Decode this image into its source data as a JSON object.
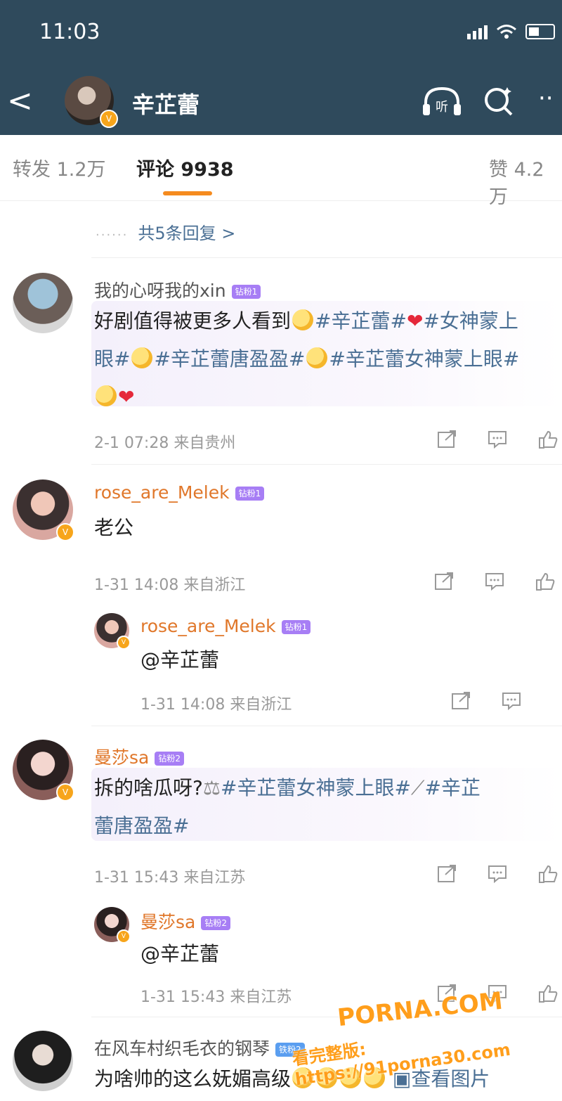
{
  "status_bar": {
    "time": "11:03"
  },
  "header": {
    "back": "<",
    "title": "辛芷蕾",
    "listen": "听",
    "more": "··"
  },
  "tabs": {
    "repost": "转发 1.2万",
    "comments": "评论 9938",
    "likes": "赞 4.2万"
  },
  "more_replies": "共5条回复 >",
  "comments": [
    {
      "name": "我的心呀我的xin",
      "badge": "钻粉1",
      "text_1": "好剧值得被更多人看到",
      "tag_1": "#辛芷蕾#",
      "tag_2": "#女神蒙上",
      "tag_3": "眼#",
      "tag_4": "#辛芷蕾唐盈盈#",
      "tag_5": "#辛芷蕾女神蒙上眼#",
      "meta": "2-1 07:28 来自贵州"
    },
    {
      "name": "rose_are_Melek",
      "badge": "钻粉1",
      "text": "老公",
      "meta": "1-31 14:08 来自浙江",
      "reply": {
        "name": "rose_are_Melek",
        "badge": "钻粉1",
        "text": "@辛芷蕾",
        "meta": "1-31 14:08 来自浙江"
      }
    },
    {
      "name": "曼莎sa",
      "badge": "钻粉2",
      "text": "拆的啥瓜呀?",
      "tag_1": "#辛芷蕾女神蒙上眼#",
      "tag_2": "#辛芷",
      "tag_3": "蕾唐盈盈#",
      "meta": "1-31 15:43 来自江苏",
      "reply": {
        "name": "曼莎sa",
        "badge": "钻粉2",
        "text": "@辛芷蕾",
        "meta": "1-31 15:43 来自江苏"
      }
    },
    {
      "name": "在风车村织毛衣的钢琴",
      "badge": "铁粉2",
      "text": "为啥帅的这么妩媚高级",
      "see_image": "查看图片"
    }
  ],
  "watermark": {
    "line1": "PORNA.COM",
    "line2": "看完整版: https://91porna30.com"
  },
  "colors": {
    "header_bg": "#2f4a5c",
    "accent": "#f58b1f",
    "link": "#4a6f94",
    "name_orange": "#e0772a"
  }
}
